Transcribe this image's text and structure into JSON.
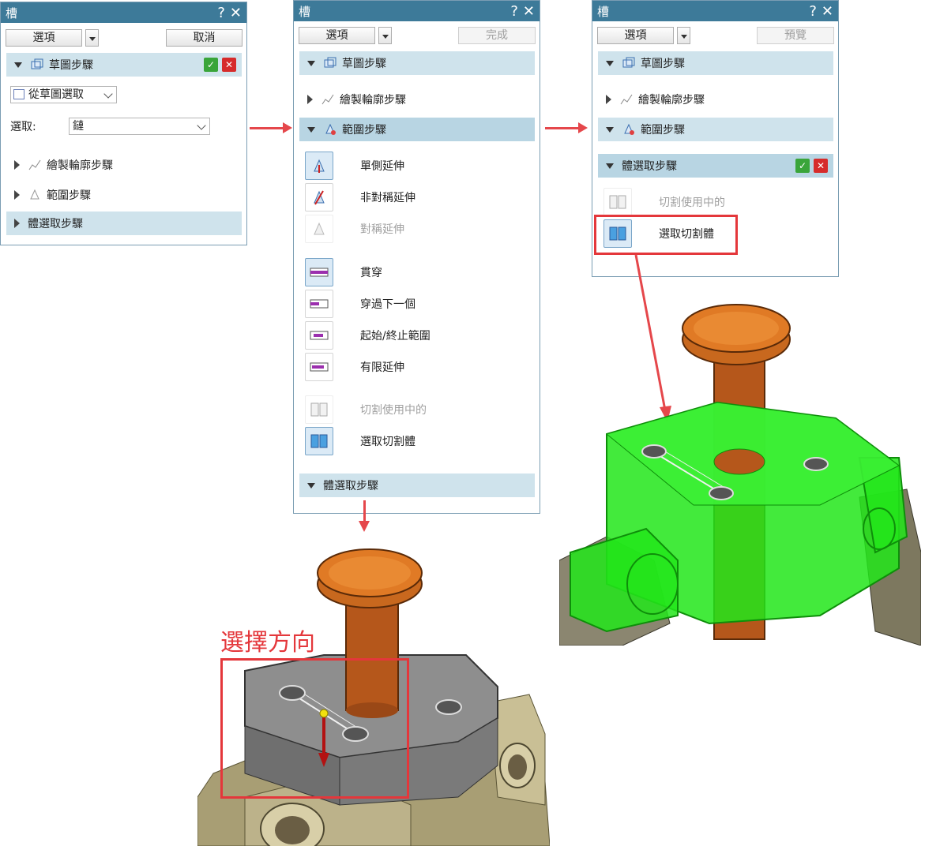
{
  "dialog1": {
    "title": "槽",
    "options_btn": "選項",
    "cancel_btn": "取消",
    "sketch_step": "草圖步驟",
    "from_sketch": "從草圖選取",
    "select_label": "選取:",
    "select_value": "鏈",
    "draw_profile": "繪製輪廓步驟",
    "range_step": "範圍步驟",
    "body_select": "體選取步驟"
  },
  "dialog2": {
    "title": "槽",
    "options_btn": "選項",
    "finish_btn": "完成",
    "sketch_step": "草圖步驟",
    "draw_profile": "繪製輪廓步驟",
    "range_step": "範圍步驟",
    "opt_one_side": "單側延伸",
    "opt_asym": "非對稱延伸",
    "opt_sym": "對稱延伸",
    "opt_through": "貫穿",
    "opt_next": "穿過下一個",
    "opt_from_to": "起始/終止範圍",
    "opt_finite": "有限延伸",
    "opt_cut_active": "切割使用中的",
    "opt_select_cut": "選取切割體",
    "body_select": "體選取步驟"
  },
  "dialog3": {
    "title": "槽",
    "options_btn": "選項",
    "preview_btn": "預覽",
    "sketch_step": "草圖步驟",
    "draw_profile": "繪製輪廓步驟",
    "range_step": "範圍步驟",
    "body_select": "體選取步驟",
    "opt_cut_active": "切割使用中的",
    "opt_select_cut": "選取切割體"
  },
  "annotation": {
    "choose_direction": "選擇方向"
  },
  "colors": {
    "title_bar": "#3d7a99",
    "section": "#cfe3ec",
    "red_annotation": "#e4373b",
    "knob": "#c8681e",
    "green_body": "#22e61a"
  }
}
